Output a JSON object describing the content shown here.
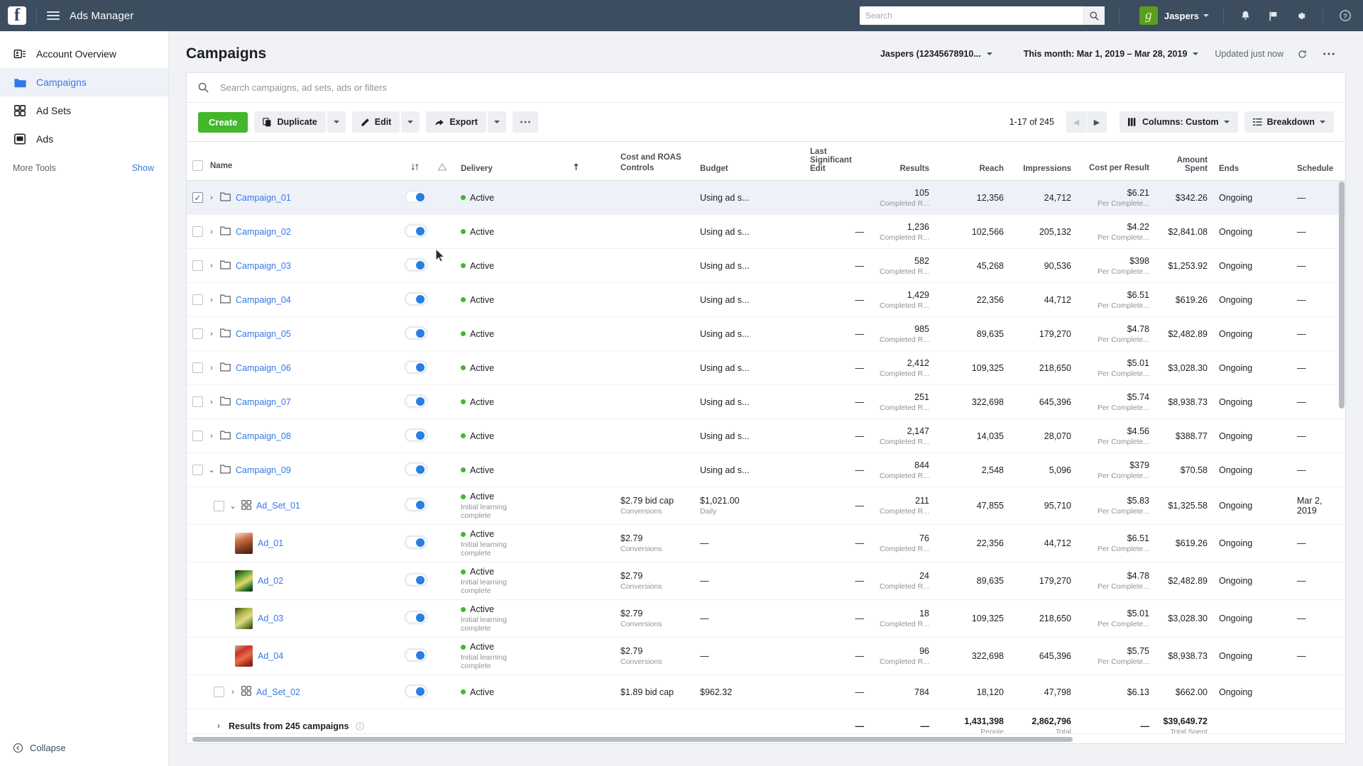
{
  "topbar": {
    "logo": "facebook-logo",
    "menu_icon": "hamburger-icon",
    "title": "Ads Manager",
    "search_placeholder": "Search",
    "search_value": "",
    "search_icon": "search-icon",
    "account_name": "Jaspers",
    "account_logo_letter": "g",
    "icons": [
      "bell-icon",
      "flag-icon",
      "gear-icon",
      "help-icon"
    ]
  },
  "sidebar": {
    "items": [
      {
        "label": "Account Overview",
        "icon": "account-overview-icon",
        "active": false
      },
      {
        "label": "Campaigns",
        "icon": "folder-icon",
        "active": true
      },
      {
        "label": "Ad Sets",
        "icon": "grid-icon",
        "active": false
      },
      {
        "label": "Ads",
        "icon": "ad-icon",
        "active": false
      }
    ],
    "more_tools_label": "More Tools",
    "more_tools_action": "Show",
    "collapse_label": "Collapse"
  },
  "header": {
    "title": "Campaigns",
    "account_selector": "Jaspers (12345678910...",
    "date_range": "This month: Mar 1, 2019 – Mar 28, 2019",
    "updated_status": "Updated just now",
    "refresh_icon": "refresh-icon",
    "more_icon": "ellipsis-icon"
  },
  "search": {
    "placeholder": "Search campaigns, ad sets, ads or filters",
    "value": "",
    "icon": "search-icon"
  },
  "toolbar": {
    "create_label": "Create",
    "duplicate_label": "Duplicate",
    "edit_label": "Edit",
    "export_label": "Export",
    "more_label": "···",
    "pagination": "1-17 of 245",
    "prev_icon": "chevron-left-icon",
    "next_icon": "chevron-right-icon",
    "columns_label": "Columns: Custom",
    "breakdown_label": "Breakdown"
  },
  "table": {
    "columns": [
      "Name",
      "Delivery",
      "Cost and ROAS Controls",
      "Budget",
      "Last Significant Edit",
      "Results",
      "Reach",
      "Impressions",
      "Cost per Result",
      "Amount Spent",
      "Ends",
      "Schedule"
    ],
    "sort_icon": "sort-icon",
    "warning_icon": "warning-icon",
    "sort_asc_icon": "sort-asc-icon",
    "rows": [
      {
        "type": "campaign",
        "name": "Campaign_01",
        "selected": true,
        "expanded": false,
        "status": "Active",
        "status_sub": "",
        "cost_control": "",
        "cost_control_sub": "",
        "budget": "Using ad s...",
        "budget_sub": "",
        "last_edit": "",
        "results": "105",
        "results_sub": "Completed R...",
        "reach": "12,356",
        "impressions": "24,712",
        "cpr": "$6.21",
        "cpr_sub": "Per Complete...",
        "spent": "$342.26",
        "ends": "Ongoing",
        "schedule": "—"
      },
      {
        "type": "campaign",
        "name": "Campaign_02",
        "selected": false,
        "expanded": false,
        "status": "Active",
        "status_sub": "",
        "cost_control": "",
        "cost_control_sub": "",
        "budget": "Using ad s...",
        "budget_sub": "",
        "last_edit": "—",
        "results": "1,236",
        "results_sub": "Completed R...",
        "reach": "102,566",
        "impressions": "205,132",
        "cpr": "$4.22",
        "cpr_sub": "Per Complete...",
        "spent": "$2,841.08",
        "ends": "Ongoing",
        "schedule": "—"
      },
      {
        "type": "campaign",
        "name": "Campaign_03",
        "selected": false,
        "expanded": false,
        "status": "Active",
        "status_sub": "",
        "cost_control": "",
        "cost_control_sub": "",
        "budget": "Using ad s...",
        "budget_sub": "",
        "last_edit": "—",
        "results": "582",
        "results_sub": "Completed R...",
        "reach": "45,268",
        "impressions": "90,536",
        "cpr": "$398",
        "cpr_sub": "Per Complete...",
        "spent": "$1,253.92",
        "ends": "Ongoing",
        "schedule": "—"
      },
      {
        "type": "campaign",
        "name": "Campaign_04",
        "selected": false,
        "expanded": false,
        "status": "Active",
        "status_sub": "",
        "cost_control": "",
        "cost_control_sub": "",
        "budget": "Using ad s...",
        "budget_sub": "",
        "last_edit": "—",
        "results": "1,429",
        "results_sub": "Completed R...",
        "reach": "22,356",
        "impressions": "44,712",
        "cpr": "$6.51",
        "cpr_sub": "Per Complete...",
        "spent": "$619.26",
        "ends": "Ongoing",
        "schedule": "—"
      },
      {
        "type": "campaign",
        "name": "Campaign_05",
        "selected": false,
        "expanded": false,
        "status": "Active",
        "status_sub": "",
        "cost_control": "",
        "cost_control_sub": "",
        "budget": "Using ad s...",
        "budget_sub": "",
        "last_edit": "—",
        "results": "985",
        "results_sub": "Completed R...",
        "reach": "89,635",
        "impressions": "179,270",
        "cpr": "$4.78",
        "cpr_sub": "Per Complete...",
        "spent": "$2,482.89",
        "ends": "Ongoing",
        "schedule": "—"
      },
      {
        "type": "campaign",
        "name": "Campaign_06",
        "selected": false,
        "expanded": false,
        "status": "Active",
        "status_sub": "",
        "cost_control": "",
        "cost_control_sub": "",
        "budget": "Using ad s...",
        "budget_sub": "",
        "last_edit": "—",
        "results": "2,412",
        "results_sub": "Completed R...",
        "reach": "109,325",
        "impressions": "218,650",
        "cpr": "$5.01",
        "cpr_sub": "Per Complete...",
        "spent": "$3,028.30",
        "ends": "Ongoing",
        "schedule": "—"
      },
      {
        "type": "campaign",
        "name": "Campaign_07",
        "selected": false,
        "expanded": false,
        "status": "Active",
        "status_sub": "",
        "cost_control": "",
        "cost_control_sub": "",
        "budget": "Using ad s...",
        "budget_sub": "",
        "last_edit": "—",
        "results": "251",
        "results_sub": "Completed R...",
        "reach": "322,698",
        "impressions": "645,396",
        "cpr": "$5.74",
        "cpr_sub": "Per Complete...",
        "spent": "$8,938.73",
        "ends": "Ongoing",
        "schedule": "—"
      },
      {
        "type": "campaign",
        "name": "Campaign_08",
        "selected": false,
        "expanded": false,
        "status": "Active",
        "status_sub": "",
        "cost_control": "",
        "cost_control_sub": "",
        "budget": "Using ad s...",
        "budget_sub": "",
        "last_edit": "—",
        "results": "2,147",
        "results_sub": "Completed R...",
        "reach": "14,035",
        "impressions": "28,070",
        "cpr": "$4.56",
        "cpr_sub": "Per Complete...",
        "spent": "$388.77",
        "ends": "Ongoing",
        "schedule": "—"
      },
      {
        "type": "campaign",
        "name": "Campaign_09",
        "selected": false,
        "expanded": true,
        "status": "Active",
        "status_sub": "",
        "cost_control": "",
        "cost_control_sub": "",
        "budget": "Using ad s...",
        "budget_sub": "",
        "last_edit": "—",
        "results": "844",
        "results_sub": "Completed R...",
        "reach": "2,548",
        "impressions": "5,096",
        "cpr": "$379",
        "cpr_sub": "Per Complete...",
        "spent": "$70.58",
        "ends": "Ongoing",
        "schedule": "—"
      },
      {
        "type": "adset",
        "name": "Ad_Set_01",
        "selected": false,
        "expanded": true,
        "status": "Active",
        "status_sub": "Initial learning complete",
        "cost_control": "$2.79 bid cap",
        "cost_control_sub": "Conversions",
        "budget": "$1,021.00",
        "budget_sub": "Daily",
        "last_edit": "—",
        "results": "211",
        "results_sub": "Completed R...",
        "reach": "47,855",
        "impressions": "95,710",
        "cpr": "$5.83",
        "cpr_sub": "Per Complete...",
        "spent": "$1,325.58",
        "ends": "Ongoing",
        "schedule": "Mar 2, 2019"
      },
      {
        "type": "ad",
        "name": "Ad_01",
        "thumb": "th1",
        "selected": false,
        "status": "Active",
        "status_sub": "Initial learning complete",
        "cost_control": "$2.79",
        "cost_control_sub": "Conversions",
        "budget": "—",
        "budget_sub": "",
        "last_edit": "—",
        "results": "76",
        "results_sub": "Completed R...",
        "reach": "22,356",
        "impressions": "44,712",
        "cpr": "$6.51",
        "cpr_sub": "Per Complete...",
        "spent": "$619.26",
        "ends": "Ongoing",
        "schedule": "—"
      },
      {
        "type": "ad",
        "name": "Ad_02",
        "thumb": "th2",
        "selected": false,
        "status": "Active",
        "status_sub": "Initial learning complete",
        "cost_control": "$2.79",
        "cost_control_sub": "Conversions",
        "budget": "—",
        "budget_sub": "",
        "last_edit": "—",
        "results": "24",
        "results_sub": "Completed R...",
        "reach": "89,635",
        "impressions": "179,270",
        "cpr": "$4.78",
        "cpr_sub": "Per Complete...",
        "spent": "$2,482.89",
        "ends": "Ongoing",
        "schedule": "—"
      },
      {
        "type": "ad",
        "name": "Ad_03",
        "thumb": "th3",
        "selected": false,
        "status": "Active",
        "status_sub": "Initial learning complete",
        "cost_control": "$2.79",
        "cost_control_sub": "Conversions",
        "budget": "—",
        "budget_sub": "",
        "last_edit": "—",
        "results": "18",
        "results_sub": "Completed R...",
        "reach": "109,325",
        "impressions": "218,650",
        "cpr": "$5.01",
        "cpr_sub": "Per Complete...",
        "spent": "$3,028.30",
        "ends": "Ongoing",
        "schedule": "—"
      },
      {
        "type": "ad",
        "name": "Ad_04",
        "thumb": "th4",
        "selected": false,
        "status": "Active",
        "status_sub": "Initial learning complete",
        "cost_control": "$2.79",
        "cost_control_sub": "Conversions",
        "budget": "—",
        "budget_sub": "",
        "last_edit": "—",
        "results": "96",
        "results_sub": "Completed R...",
        "reach": "322,698",
        "impressions": "645,396",
        "cpr": "$5.75",
        "cpr_sub": "Per Complete...",
        "spent": "$8,938.73",
        "ends": "Ongoing",
        "schedule": "—"
      },
      {
        "type": "adset",
        "name": "Ad_Set_02",
        "selected": false,
        "expanded": false,
        "status": "Active",
        "status_sub": "",
        "cost_control": "$1.89 bid cap",
        "cost_control_sub": "",
        "budget": "$962.32",
        "budget_sub": "",
        "last_edit": "—",
        "results": "784",
        "results_sub": "",
        "reach": "18,120",
        "impressions": "47,798",
        "cpr": "$6.13",
        "cpr_sub": "",
        "spent": "$662.00",
        "ends": "Ongoing",
        "schedule": ""
      }
    ],
    "totals": {
      "label": "Results from 245 campaigns",
      "info_icon": "info-icon",
      "last_edit": "—",
      "results": "—",
      "reach": "1,431,398",
      "reach_sub": "People",
      "impressions": "2,862,796",
      "impressions_sub": "Total",
      "cpr": "—",
      "spent": "$39,649.72",
      "spent_sub": "Total Spent"
    }
  },
  "colors": {
    "topbar_bg": "#3b4d5e",
    "accent_blue": "#3578e5",
    "create_green": "#42b72a",
    "active_green": "#42b72a",
    "selected_row": "#eef1f8"
  }
}
